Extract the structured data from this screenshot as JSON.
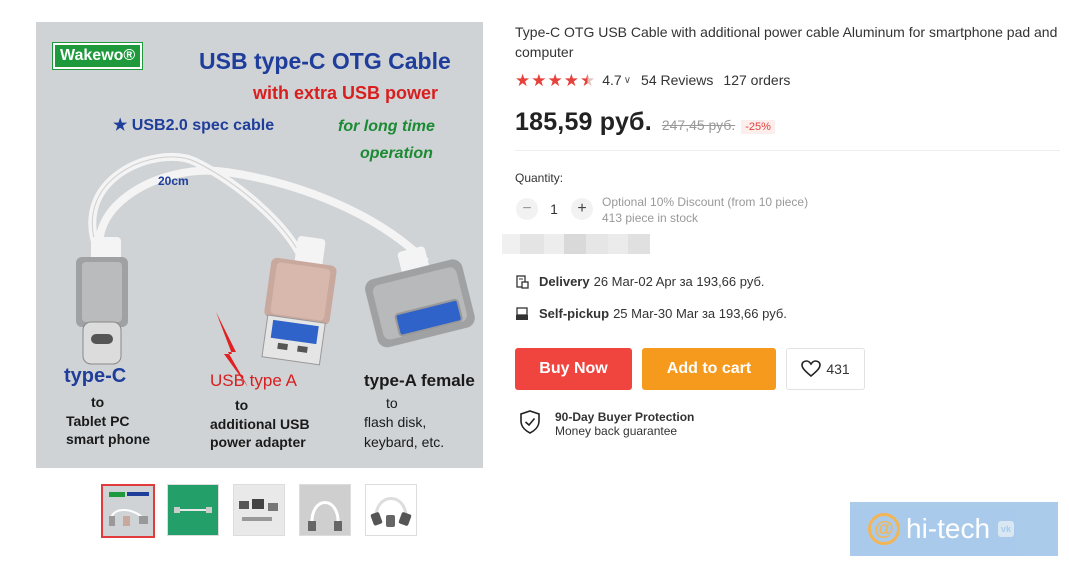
{
  "product_image": {
    "brand": "Wakewo®",
    "headline": "USB type-C OTG Cable",
    "subheadline": "with extra USB power",
    "spec": "★ USB2.0 spec cable",
    "usage_line1": "for long time",
    "usage_line2": "operation",
    "cable_length": "20cm",
    "typec_title": "type-C",
    "typec_to": "to",
    "typec_line1": "Tablet PC",
    "typec_line2": "smart phone",
    "usba_title": "USB type A",
    "usba_to": "to",
    "usba_line1": "additional USB",
    "usba_line2": "power adapter",
    "female_title": "type-A female",
    "female_to": "to",
    "female_line1": "flash disk,",
    "female_line2": "keybard, etc."
  },
  "product": {
    "title": "Type-C OTG USB Cable with additional power cable Aluminum for smartphone pad and computer",
    "rating": "4.7",
    "reviews": "54 Reviews",
    "orders": "127 orders",
    "stars_value": 4.5,
    "price": "185,59 руб.",
    "old_price": "247,45 руб.",
    "discount": "-25%"
  },
  "quantity": {
    "label": "Quantity:",
    "value": "1",
    "minus": "−",
    "plus": "+",
    "discount_note": "Optional 10% Discount (from 10 piece)",
    "stock": "413 piece in stock"
  },
  "shipping": {
    "delivery_label": "Delivery",
    "delivery_text": "26 Mar-02 Apr за 193,66 руб.",
    "pickup_label": "Self-pickup",
    "pickup_text": "25 Mar-30 Mar за 193,66 руб."
  },
  "actions": {
    "buy_now": "Buy Now",
    "add_to_cart": "Add to cart",
    "wishlist_count": "431"
  },
  "protection": {
    "title": "90-Day Buyer Protection",
    "subtitle": "Money back guarantee"
  },
  "watermark": {
    "text": "hi-tech",
    "at": "@",
    "badge": "vk"
  },
  "colors": {
    "accent_red": "#f0453e",
    "accent_orange": "#f59a1d",
    "star": "#e6413a"
  }
}
